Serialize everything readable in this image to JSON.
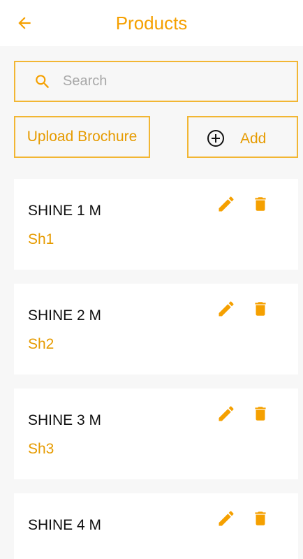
{
  "header": {
    "title": "Products",
    "back_icon": "arrow-left-icon"
  },
  "search": {
    "placeholder": "Search",
    "value": "",
    "icon": "search-icon"
  },
  "actions": {
    "upload_label": "Upload Brochure",
    "add_label": "Add",
    "add_icon": "plus-circle-icon"
  },
  "products": [
    {
      "name": "SHINE 1 M",
      "code": "Sh1"
    },
    {
      "name": "SHINE 2 M",
      "code": "Sh2"
    },
    {
      "name": "SHINE 3 M",
      "code": "Sh3"
    },
    {
      "name": "SHINE 4 M",
      "code": ""
    }
  ],
  "colors": {
    "accent": "#f5a000",
    "border": "#f2b633",
    "background": "#f7f7f7",
    "card": "#ffffff"
  }
}
